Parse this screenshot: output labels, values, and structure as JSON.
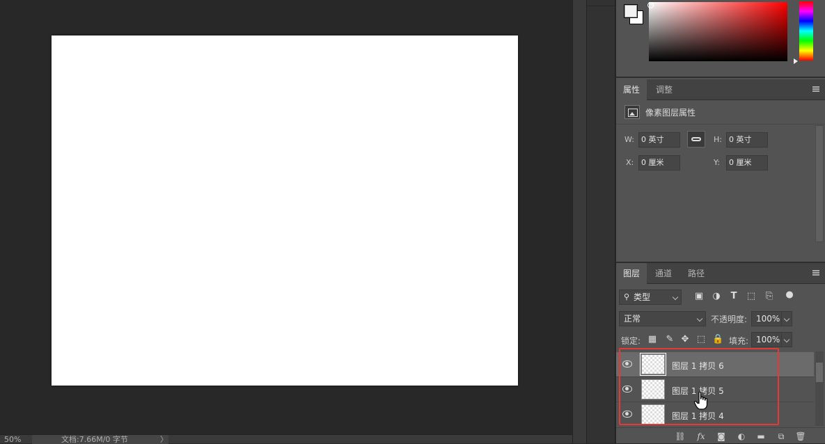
{
  "status": {
    "zoom": "50%",
    "doc_info": "文档:7.66M/0 字节",
    "arrow": "〉"
  },
  "properties": {
    "tabs": [
      "属性",
      "调整"
    ],
    "title": "像素图层属性",
    "w_label": "W:",
    "w_value": "0 英寸",
    "h_label": "H:",
    "h_value": "0 英寸",
    "x_label": "X:",
    "x_value": "0 厘米",
    "y_label": "Y:",
    "y_value": "0 厘米"
  },
  "layers": {
    "tabs": [
      "图层",
      "通道",
      "路径"
    ],
    "filter_kind": "类型",
    "blend_mode": "正常",
    "opacity_label": "不透明度:",
    "opacity_value": "100%",
    "lock_label": "锁定:",
    "fill_label": "填充:",
    "fill_value": "100%",
    "items": [
      {
        "name": "图层 1 拷贝 6"
      },
      {
        "name": "图层 1 拷贝 5"
      },
      {
        "name": "图层 1 拷贝 4"
      }
    ],
    "footer_fx": "fx"
  },
  "colors": {
    "highlight": "#e53935",
    "selected_row": "#6b6b6b",
    "panel_bg": "#535353"
  }
}
